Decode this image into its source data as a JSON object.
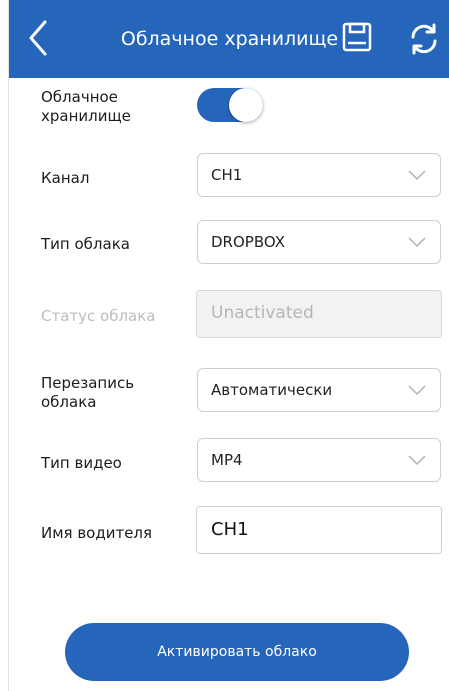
{
  "header": {
    "title": "Облачное хранилище",
    "icons": {
      "back": "chevron-left-icon",
      "save": "save-icon",
      "sync": "sync-icon"
    }
  },
  "form": {
    "cloud_storage": {
      "label_line1": "Облачное",
      "label_line2": "хранилище",
      "enabled": true
    },
    "channel": {
      "label": "Канал",
      "value": "CH1"
    },
    "cloud_type": {
      "label": "Тип облака",
      "value": "DROPBOX"
    },
    "cloud_status": {
      "label": "Статус облака",
      "value": "Unactivated"
    },
    "cloud_overwrite": {
      "label_line1": "Перезапись",
      "label_line2": "облака",
      "value": "Автоматически"
    },
    "video_type": {
      "label": "Тип видео",
      "value": "MP4"
    },
    "driver_name": {
      "label": "Имя водителя",
      "value": "CH1"
    }
  },
  "actions": {
    "activate_label": "Активировать облако"
  },
  "colors": {
    "accent": "#2666ba",
    "disabled_text": "#bdbdbd",
    "border": "#cfcfcf"
  }
}
